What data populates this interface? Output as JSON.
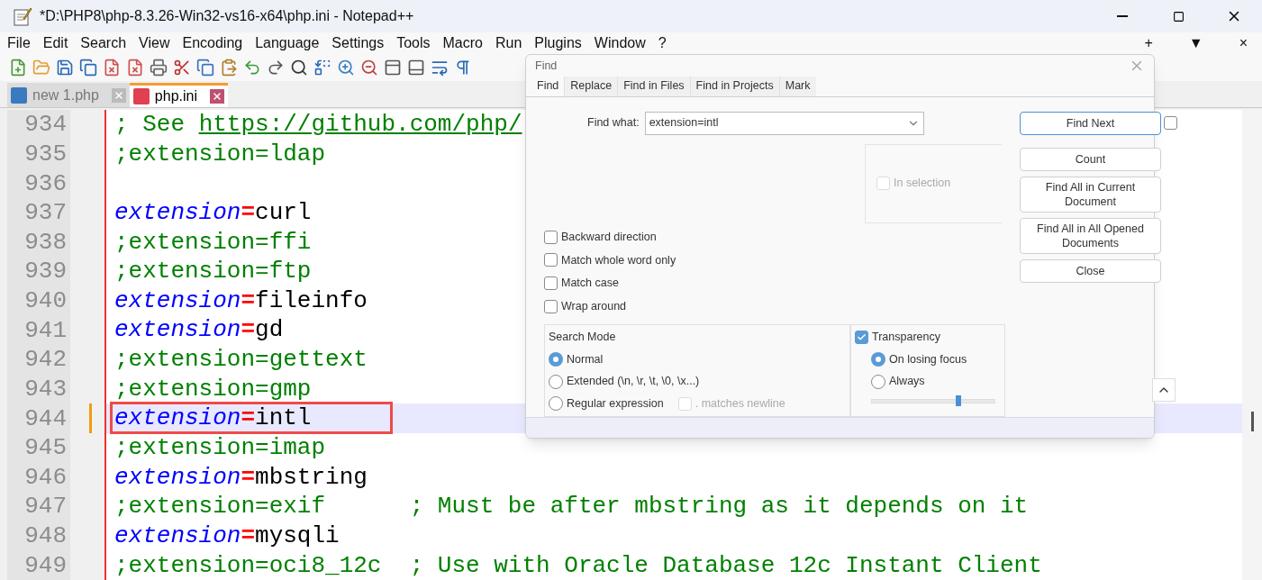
{
  "window": {
    "title": "*D:\\PHP8\\php-8.3.26-Win32-vs16-x64\\php.ini - Notepad++"
  },
  "menu": [
    "File",
    "Edit",
    "Search",
    "View",
    "Encoding",
    "Language",
    "Settings",
    "Tools",
    "Macro",
    "Run",
    "Plugins",
    "Window",
    "?"
  ],
  "menu_right": [
    "+",
    "▼",
    "×"
  ],
  "tabs": [
    {
      "label": "new 1.php",
      "selected": false,
      "modified": false
    },
    {
      "label": "php.ini",
      "selected": true,
      "modified": true
    }
  ],
  "lines": [
    {
      "number": "934",
      "kind": "comment_link",
      "text": "; See ",
      "link": "https://github.com/php/",
      "current": false,
      "boxed": false
    },
    {
      "number": "935",
      "kind": "comment",
      "text": ";extension=ldap",
      "current": false,
      "boxed": false
    },
    {
      "number": "936",
      "kind": "blank",
      "current": false,
      "boxed": false
    },
    {
      "number": "937",
      "kind": "directive",
      "key": "extension",
      "op": "=",
      "value": "curl",
      "current": false,
      "boxed": false
    },
    {
      "number": "938",
      "kind": "comment",
      "text": ";extension=ffi",
      "current": false,
      "boxed": false
    },
    {
      "number": "939",
      "kind": "comment",
      "text": ";extension=ftp",
      "current": false,
      "boxed": false
    },
    {
      "number": "940",
      "kind": "directive",
      "key": "extension",
      "op": "=",
      "value": "fileinfo",
      "current": false,
      "boxed": false
    },
    {
      "number": "941",
      "kind": "directive",
      "key": "extension",
      "op": "=",
      "value": "gd",
      "current": false,
      "boxed": false
    },
    {
      "number": "942",
      "kind": "comment",
      "text": ";extension=gettext",
      "current": false,
      "boxed": false
    },
    {
      "number": "943",
      "kind": "comment",
      "text": ";extension=gmp",
      "current": false,
      "boxed": false
    },
    {
      "number": "944",
      "kind": "directive",
      "key": "extension",
      "op": "=",
      "value": "intl",
      "current": true,
      "boxed": true
    },
    {
      "number": "945",
      "kind": "comment",
      "text": ";extension=imap",
      "current": false,
      "boxed": false
    },
    {
      "number": "946",
      "kind": "directive",
      "key": "extension",
      "op": "=",
      "value": "mbstring",
      "current": false,
      "boxed": false
    },
    {
      "number": "947",
      "kind": "comment",
      "text": ";extension=exif      ; Must be after mbstring as it depends on it",
      "current": false,
      "boxed": false
    },
    {
      "number": "948",
      "kind": "directive",
      "key": "extension",
      "op": "=",
      "value": "mysqli",
      "current": false,
      "boxed": false
    },
    {
      "number": "949",
      "kind": "comment",
      "text": ";extension=oci8_12c  ; Use with Oracle Database 12c Instant Client",
      "current": false,
      "boxed": false
    }
  ],
  "find_dialog": {
    "title": "Find",
    "tabs": [
      {
        "label": "Find",
        "selected": true
      },
      {
        "label": "Replace",
        "selected": false
      },
      {
        "label": "Find in Files",
        "selected": false
      },
      {
        "label": "Find in Projects",
        "selected": false
      },
      {
        "label": "Mark",
        "selected": false
      }
    ],
    "find_what": {
      "label": "Find what:",
      "value": "extension=intl"
    },
    "side_checkbox": {
      "checked": false
    },
    "buttons": [
      {
        "label": "Find Next",
        "default": true
      },
      {
        "label": "Count",
        "default": false
      },
      {
        "label": "Find All in Current Document",
        "default": false
      },
      {
        "label": "Find All in All Opened Documents",
        "default": false
      },
      {
        "label": "Close",
        "default": false
      }
    ],
    "in_selection": {
      "label": "In selection",
      "checked": false,
      "disabled": true
    },
    "options": [
      {
        "label": "Backward direction",
        "checked": false
      },
      {
        "label": "Match whole word only",
        "checked": false
      },
      {
        "label": "Match case",
        "checked": false
      },
      {
        "label": "Wrap around",
        "checked": false
      }
    ],
    "search_mode": {
      "title": "Search Mode",
      "modes": [
        {
          "label": "Normal",
          "selected": true
        },
        {
          "label": "Extended (\\n, \\r, \\t, \\0, \\x...)",
          "selected": false
        },
        {
          "label": "Regular expression",
          "selected": false
        }
      ],
      "matches_newline": {
        "label": ". matches newline",
        "checked": false,
        "disabled": true
      }
    },
    "transparency": {
      "label": "Transparency",
      "checked": true,
      "modes": [
        {
          "label": "On losing focus",
          "selected": true
        },
        {
          "label": "Always",
          "selected": false
        }
      ],
      "level": 0.7
    }
  }
}
